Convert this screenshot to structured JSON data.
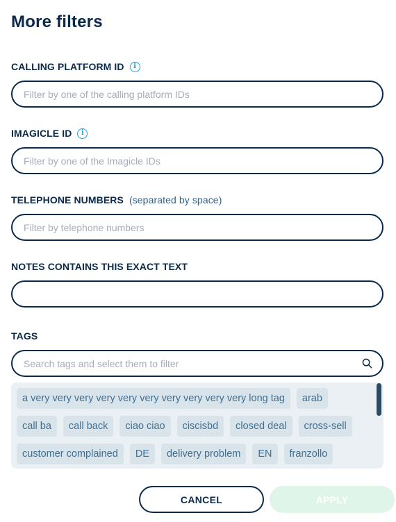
{
  "dialog": {
    "title": "More filters"
  },
  "calling_platform": {
    "label": "CALLING PLATFORM ID",
    "placeholder": "Filter by one of the calling platform IDs",
    "value": ""
  },
  "imagicle": {
    "label": "IMAGICLE ID",
    "placeholder": "Filter by one of the Imagicle IDs",
    "value": ""
  },
  "telephone": {
    "label": "TELEPHONE NUMBERS",
    "hint": "(separated by space)",
    "placeholder": "Filter by telephone numbers",
    "value": ""
  },
  "notes": {
    "label": "NOTES CONTAINS THIS EXACT TEXT",
    "value": ""
  },
  "tags": {
    "label": "TAGS",
    "search_placeholder": "Search tags and select them to filter",
    "items": [
      "a very very very very very very very very very very long tag",
      "arab",
      "call ba",
      "call back",
      "ciao ciao",
      "ciscisbd",
      "closed deal",
      "cross-sell",
      "customer complained",
      "DE",
      "delivery problem",
      "EN",
      "franzollo"
    ]
  },
  "actions": {
    "cancel": "CANCEL",
    "apply": "APPLY"
  },
  "colors": {
    "primary": "#0b2a4a",
    "info": "#1aa3d6",
    "tag_bg": "#d9e3ea",
    "tag_text": "#3f6f92",
    "apply_disabled_bg": "#dff5ea"
  },
  "icons": {
    "info": "info-icon",
    "search": "search-icon"
  }
}
